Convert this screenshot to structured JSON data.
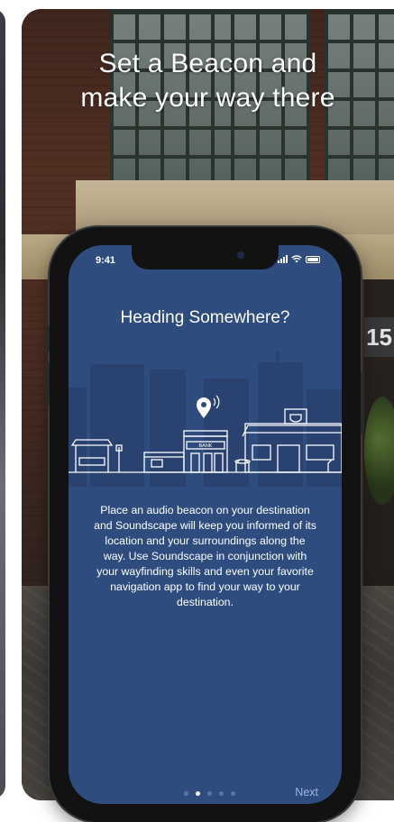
{
  "headline": {
    "line1": "Set a Beacon and",
    "line2": "make your way there"
  },
  "background": {
    "building_number": "15"
  },
  "phone": {
    "status_time": "9:41",
    "screen": {
      "title": "Heading Somewhere?",
      "bank_sign": "BANK",
      "body": "Place an audio beacon on your destination and Soundscape will keep you informed of its location and your surroundings along the way. Use Soundscape in conjunction with your wayfinding skills and even your favorite navigation app to find your way to your destination.",
      "pager": {
        "total": 5,
        "active_index": 1
      },
      "next_label": "Next"
    }
  },
  "colors": {
    "screen_bg": "#2f4c7f",
    "next_text": "#9fb4dd",
    "dot_inactive": "#5a76a6",
    "dot_active": "#ffffff"
  },
  "icons": [
    "location-pin-icon",
    "signal-bars-icon",
    "wifi-icon",
    "battery-icon"
  ]
}
